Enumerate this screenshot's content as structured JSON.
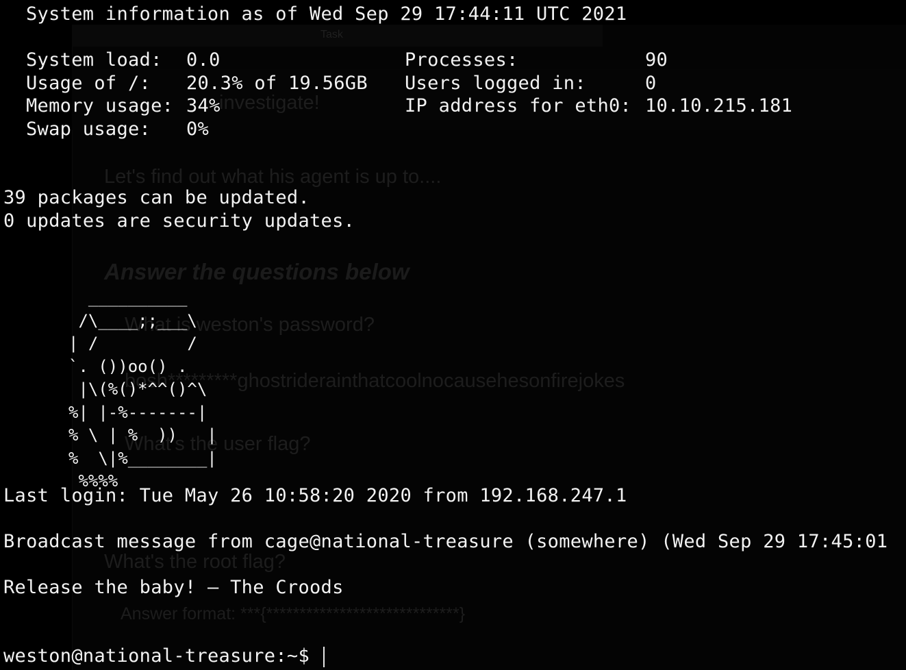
{
  "background_page": {
    "header_fragment": "Task",
    "line1": "investigate!",
    "line2": "Let's find out what his agent is up to....",
    "heading": "Answer the questions below",
    "q1": "What is weston's password?",
    "a1": "bosh*********ghostriderainthatcoolnocausehesonfirejokes",
    "q2": "What's the user flag?",
    "q3": "What's the root flag?",
    "answer_format": "Answer format: ***{*****************************}"
  },
  "terminal": {
    "sysinfo_header": "System information as of Wed Sep 29 17:44:11 UTC 2021",
    "stats_left": [
      {
        "label": "System load:",
        "value": "0.0"
      },
      {
        "label": "Usage of /:",
        "value": "20.3% of 19.56GB"
      },
      {
        "label": "Memory usage:",
        "value": "34%"
      },
      {
        "label": "Swap usage:",
        "value": "0%"
      }
    ],
    "stats_right": [
      {
        "label": "Processes:",
        "value": "90"
      },
      {
        "label": "Users logged in:",
        "value": "0"
      },
      {
        "label": "IP address for eth0:",
        "value": "10.10.215.181"
      }
    ],
    "updates_line1": "39 packages can be updated.",
    "updates_line2": "0 updates are security updates.",
    "ascii_art": "  __________\n /\\____;;___\\\n| /         /\n`. ())oo() .\n |\\(%()*^^()^\\\n%| |-%-------|\n% \\ | %  ))   |\n%  \\|%________|\n %%%%",
    "last_login": "Last login: Tue May 26 10:58:20 2020 from 192.168.247.1",
    "broadcast": "Broadcast message from cage@national-treasure (somewhere) (Wed Sep 29 17:45:01",
    "message": "Release the baby! — The Croods",
    "prompt": "weston@national-treasure:~$ "
  }
}
